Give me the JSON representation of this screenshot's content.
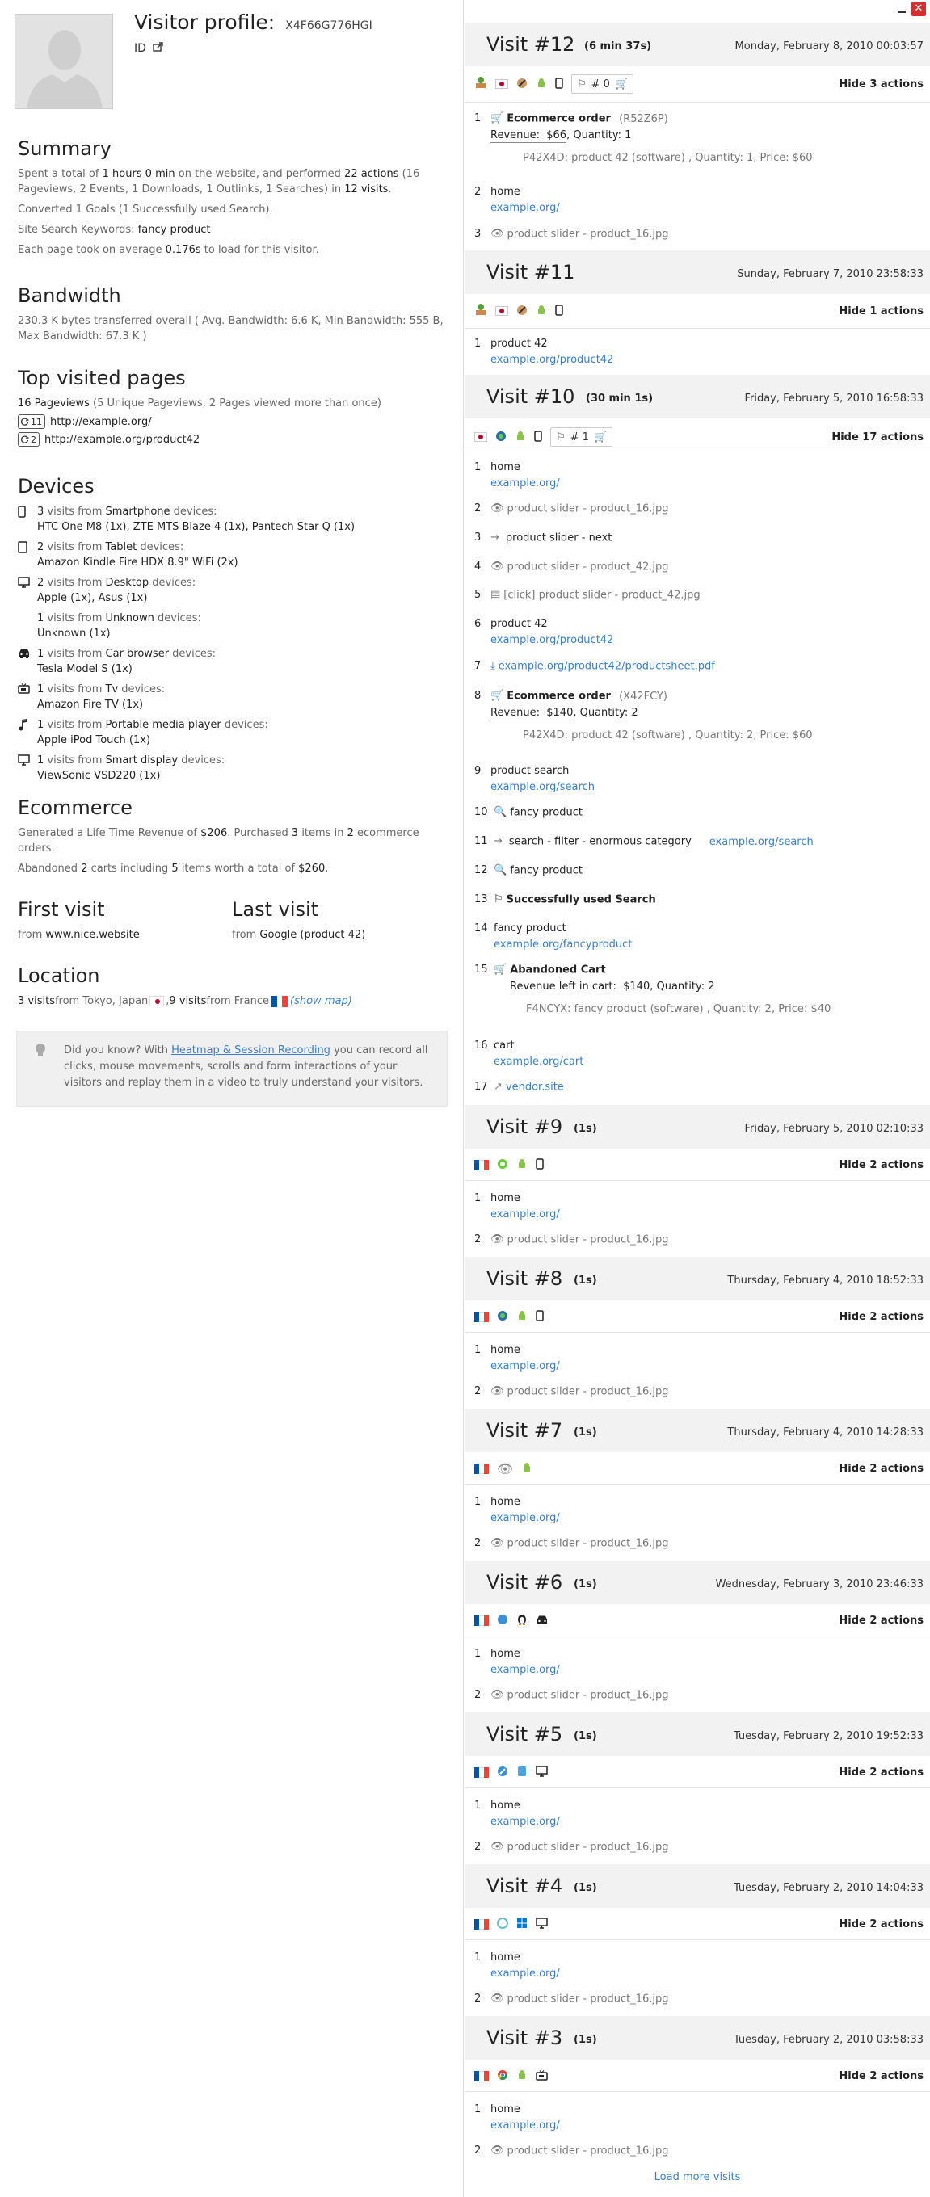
{
  "window": {
    "close": "✕"
  },
  "profile": {
    "title": "Visitor profile:",
    "visitor_id": "X4F66G776HGI",
    "id_label": "ID"
  },
  "summary": {
    "heading": "Summary",
    "p1": {
      "a": "Spent a total of ",
      "time": "1 hours 0 min",
      "b": " on the website, and performed ",
      "actions": "22 actions",
      "c": " (16 Pageviews, 2 Events, 1 Downloads, 1 Outlinks, 1 Searches) in ",
      "visits": "12 visits",
      "d": "."
    },
    "p2": "Converted 1 Goals (1 Successfully used Search).",
    "p3": {
      "label": "Site Search Keywords: ",
      "value": "fancy product"
    },
    "p4": {
      "a": "Each page took on average ",
      "value": "0.176s",
      "b": " to load for this visitor."
    }
  },
  "bandwidth": {
    "heading": "Bandwidth",
    "text": "230.3 K bytes transferred overall ( Avg. Bandwidth: 6.6 K, Min Bandwidth: 555 B, Max Bandwidth: 67.3 K )"
  },
  "top_pages": {
    "heading": "Top visited pages",
    "summary": {
      "a": "16 Pageviews",
      "b": " (5 Unique Pageviews, 2 Pages viewed more than once)"
    },
    "pages": [
      {
        "count": "11",
        "url": "http://example.org/"
      },
      {
        "count": "2",
        "url": "http://example.org/product42"
      }
    ]
  },
  "devices": {
    "heading": "Devices",
    "items": [
      {
        "icon": "smartphone-icon",
        "count": "3",
        "type": "Smartphone",
        "models": "HTC One M8 (1x), ZTE MTS Blaze 4 (1x), Pantech Star Q (1x)"
      },
      {
        "icon": "tablet-icon",
        "count": "2",
        "type": "Tablet",
        "models": "Amazon Kindle Fire HDX 8.9\" WiFi (2x)"
      },
      {
        "icon": "desktop-icon",
        "count": "2",
        "type": "Desktop",
        "models": "Apple (1x), Asus (1x)"
      },
      {
        "icon": "",
        "count": "1",
        "type": "Unknown",
        "models": "Unknown (1x)"
      },
      {
        "icon": "car-icon",
        "count": "1",
        "type": "Car browser",
        "models": "Tesla Model S (1x)"
      },
      {
        "icon": "tv-icon",
        "count": "1",
        "type": "Tv",
        "models": "Amazon Fire TV (1x)"
      },
      {
        "icon": "music-player-icon",
        "count": "1",
        "type": "Portable media player",
        "models": "Apple iPod Touch (1x)"
      },
      {
        "icon": "smart-display-icon",
        "count": "1",
        "type": "Smart display",
        "models": "ViewSonic VSD220 (1x)"
      }
    ],
    "visits_from": " visits from ",
    "devices_word": " devices:"
  },
  "ecommerce": {
    "heading": "Ecommerce",
    "p1": {
      "a": "Generated a Life Time Revenue of ",
      "revenue": "$206",
      "b": ". Purchased ",
      "items": "3",
      "c": " items in ",
      "orders": "2",
      "d": " ecommerce orders."
    },
    "p2": {
      "a": "Abandoned ",
      "carts": "2",
      "b": " carts including ",
      "items": "5",
      "c": " items worth a total of ",
      "total": "$260",
      "d": "."
    }
  },
  "first_visit": {
    "heading": "First visit",
    "from": "from ",
    "source": "www.nice.website"
  },
  "last_visit": {
    "heading": "Last visit",
    "from": "from ",
    "source": "Google (product 42)"
  },
  "location": {
    "heading": "Location",
    "a": "3 visits",
    "b": " from Tokyo, Japan ",
    "c": ", ",
    "d": "9 visits",
    "e": " from France ",
    "show_map": "(show map)"
  },
  "tip": {
    "a": "Did you know? With ",
    "link": "Heatmap & Session Recording",
    "b": " you can record all clicks, mouse movements, scrolls and form interactions of your visitors and replay them in a video to truly understand your visitors."
  },
  "visits": {
    "v12": {
      "title": "Visit #12",
      "duration": "(6 min 37s)",
      "date": "Monday, February 8, 2010 00:03:57",
      "hide": "Hide 3 actions",
      "goal": "# 0"
    },
    "v11": {
      "title": "Visit #11",
      "date": "Sunday, February 7, 2010 23:58:33",
      "hide": "Hide 1 actions"
    },
    "v10": {
      "title": "Visit #10",
      "duration": "(30 min 1s)",
      "date": "Friday, February 5, 2010 16:58:33",
      "hide": "Hide 17 actions",
      "goal": "# 1"
    },
    "v9": {
      "title": "Visit #9",
      "duration": "(1s)",
      "date": "Friday, February 5, 2010 02:10:33",
      "hide": "Hide 2 actions"
    },
    "v8": {
      "title": "Visit #8",
      "duration": "(1s)",
      "date": "Thursday, February 4, 2010 18:52:33",
      "hide": "Hide 2 actions"
    },
    "v7": {
      "title": "Visit #7",
      "duration": "(1s)",
      "date": "Thursday, February 4, 2010 14:28:33",
      "hide": "Hide 2 actions"
    },
    "v6": {
      "title": "Visit #6",
      "duration": "(1s)",
      "date": "Wednesday, February 3, 2010 23:46:33",
      "hide": "Hide 2 actions"
    },
    "v5": {
      "title": "Visit #5",
      "duration": "(1s)",
      "date": "Tuesday, February 2, 2010 19:52:33",
      "hide": "Hide 2 actions"
    },
    "v4": {
      "title": "Visit #4",
      "duration": "(1s)",
      "date": "Tuesday, February 2, 2010 14:04:33",
      "hide": "Hide 2 actions"
    },
    "v3": {
      "title": "Visit #3",
      "duration": "(1s)",
      "date": "Tuesday, February 2, 2010 03:58:33",
      "hide": "Hide 2 actions"
    }
  },
  "actions": {
    "home": "home",
    "home_url": "example.org/",
    "slider16": "product slider - product_16.jpg",
    "slider42": "product slider - product_42.jpg",
    "click_slider42": "[click] product slider - product_42.jpg",
    "slider_next": "product slider - next",
    "product42": "product 42",
    "product42_url": "example.org/product42",
    "pdf_url": "example.org/product42/productsheet.pdf",
    "product_search": "product search",
    "search_url": "example.org/search",
    "fancy_product": "fancy product",
    "filter": "search - filter - enormous category",
    "search_goal": "Successfully used Search",
    "fancy_url": "example.org/fancyproduct",
    "cart": "cart",
    "cart_url": "example.org/cart",
    "vendor": "vendor.site",
    "order_label": "Ecommerce order",
    "order12_id": "(R52Z6P)",
    "order12_revenue_label": "Revenue:",
    "order12_revenue": "$66",
    "order12_qty": ", Quantity: 1",
    "order12_item": "P42X4D: product 42 (software) , Quantity: 1, Price: $60",
    "order10_id": "(X42FCY)",
    "order10_revenue": "$140",
    "order10_qty": ", Quantity: 2",
    "order10_item": "P42X4D: product 42 (software) , Quantity: 2, Price: $60",
    "cart_label": "Abandoned Cart",
    "cart_revenue_label": "Revenue left in cart:",
    "cart_revenue": "$140",
    "cart_qty": ", Quantity: 2",
    "cart_item": "F4NCYX: fancy product (software) , Quantity: 2, Price: $40"
  },
  "load_more": "Load more visits",
  "colors": {
    "link": "#3b7ec4",
    "header_bg": "#f2f2f2",
    "text": "#222222"
  }
}
